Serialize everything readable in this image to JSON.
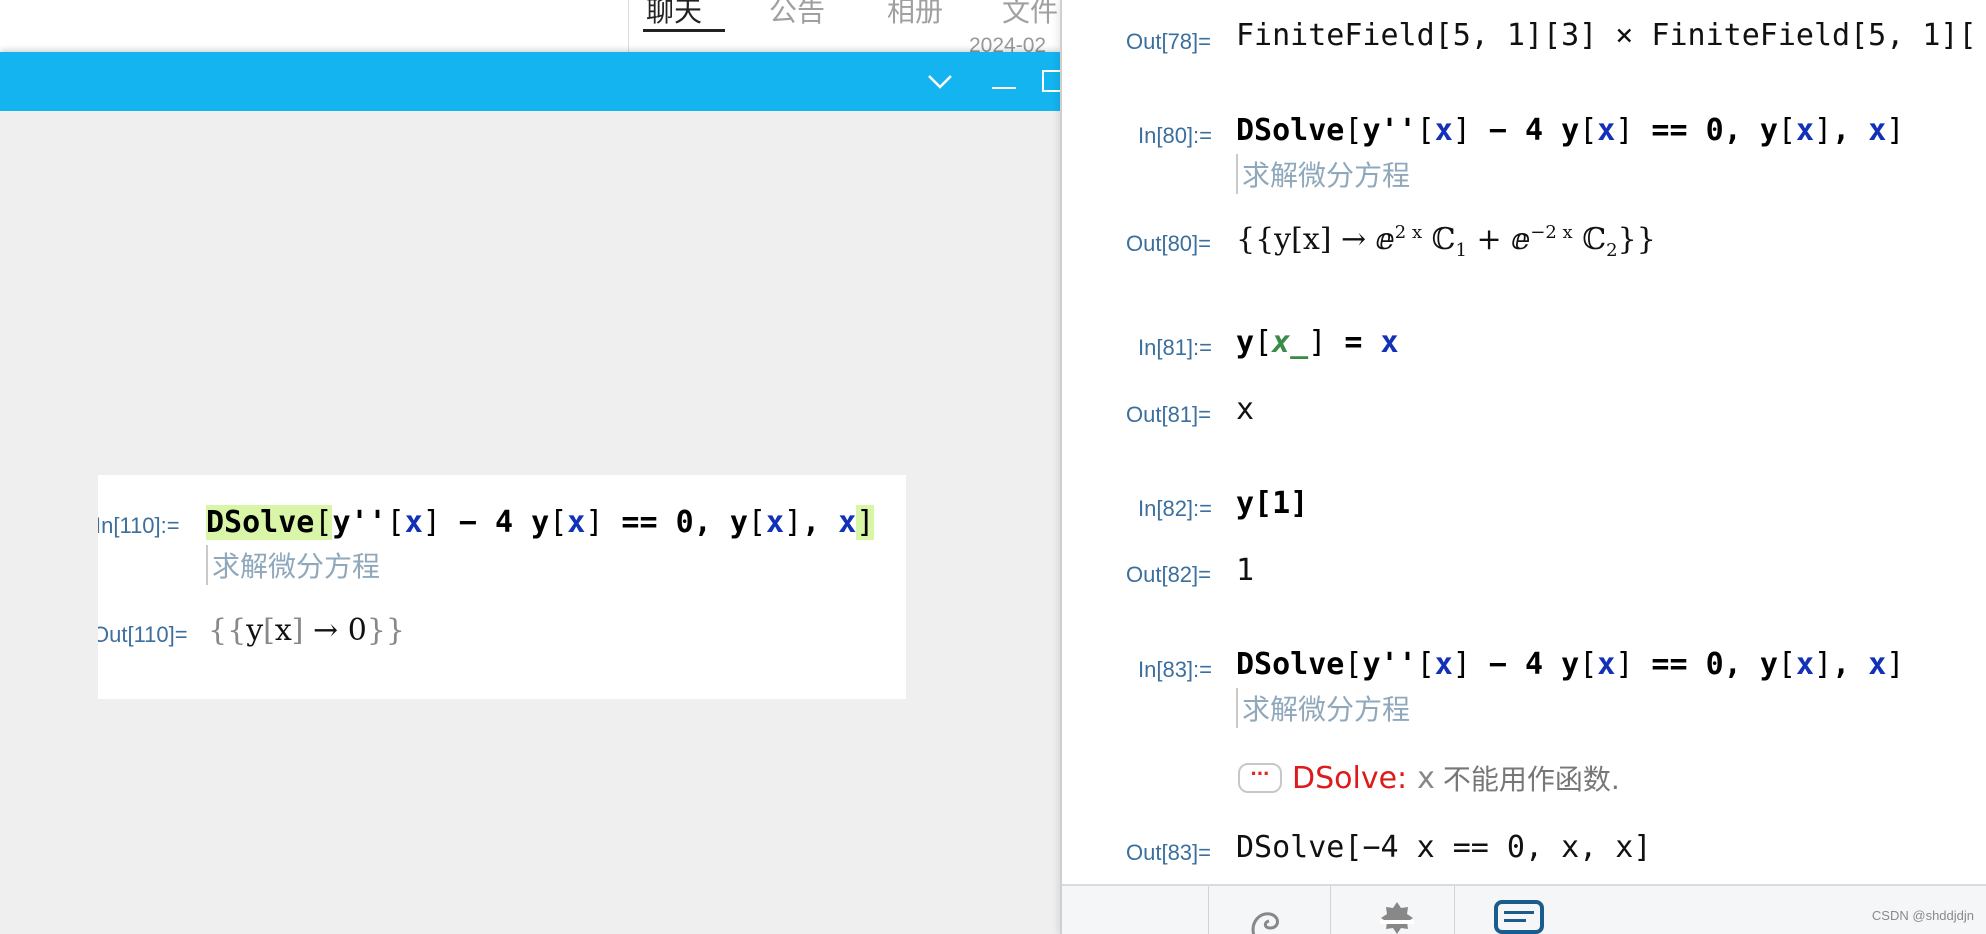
{
  "chat_window": {
    "tabs": [
      "聊天",
      "公告",
      "相册",
      "文件"
    ],
    "date": "2024-02"
  },
  "titlebar": {
    "collapse_icon": "chevron-down-icon",
    "minimize_icon": "minimize-icon",
    "accent": "#14b4f0"
  },
  "small_notebook": {
    "in_label": "In[110]:=",
    "out_label": "Out[110]=",
    "code": {
      "fn": "DSolve",
      "open": "[",
      "y1": "y''",
      "b1o": "[",
      "x1": "x",
      "b1c": "]",
      "minus": " − 4 ",
      "y2": "y",
      "b2o": "[",
      "x2": "x",
      "b2c": "]",
      "eq": " == ",
      "zero": "0",
      "c1": ", ",
      "y3": "y",
      "b3o": "[",
      "x3": "x",
      "b3c": "]",
      "c2": ", ",
      "x4": "x",
      "close": "]"
    },
    "comment": "求解微分方程",
    "output": {
      "a": "{{",
      "y": "y",
      "bo": "[",
      "x": "x",
      "bc": "]",
      "arrow": " → ",
      "val": "0",
      "z": "}}"
    }
  },
  "notebook": {
    "cells": {
      "out78": {
        "label": "Out[78]=",
        "text": "FiniteField[5, 1][3] × FiniteField[5, 1]["
      },
      "in80": {
        "label": "In[80]:=",
        "comment": "求解微分方程"
      },
      "out80": {
        "label": "Out[80]=",
        "lhs": "{{y[x] → ",
        "e1": "ⅇ",
        "exp1": "2 x",
        "c1": "ℂ",
        "sub1": "1",
        "plus": " + ",
        "e2": "ⅇ",
        "exp2": "−2 x",
        "c2": "ℂ",
        "sub2": "2",
        "rhs": "}}"
      },
      "in81": {
        "label": "In[81]:=",
        "y": "y",
        "bo": "[",
        "pat": "x_",
        "bc": "]",
        "eq": " = ",
        "x": "x"
      },
      "out81": {
        "label": "Out[81]=",
        "text": "x"
      },
      "in82": {
        "label": "In[82]:=",
        "text": "y[1]"
      },
      "out82": {
        "label": "Out[82]=",
        "text": "1"
      },
      "in83": {
        "label": "In[83]:=",
        "comment": "求解微分方程"
      },
      "msg83": {
        "icon": "···",
        "name": "DSolve:",
        "var": "x",
        "text": "不能用作函数."
      },
      "out83": {
        "label": "Out[83]=",
        "text": "DSolve[−4 x == 0, x, x]"
      }
    },
    "code": {
      "fn": "DSolve",
      "open": "[",
      "y1": "y''",
      "b1o": "[",
      "x1": "x",
      "b1c": "]",
      "minus": " − 4 ",
      "y2": "y",
      "b2o": "[",
      "x2": "x",
      "b2c": "]",
      "eq": " == ",
      "zero": "0",
      "c1": ", ",
      "y3": "y",
      "b3o": "[",
      "x3": "x",
      "b3c": "]",
      "c2": ", ",
      "x4": "x",
      "close": "]"
    }
  },
  "bottom_bar": {
    "icons": [
      "swirl-icon",
      "settings-badge-icon",
      "chat-icon"
    ],
    "watermark": "CSDN @shddjdjn"
  }
}
